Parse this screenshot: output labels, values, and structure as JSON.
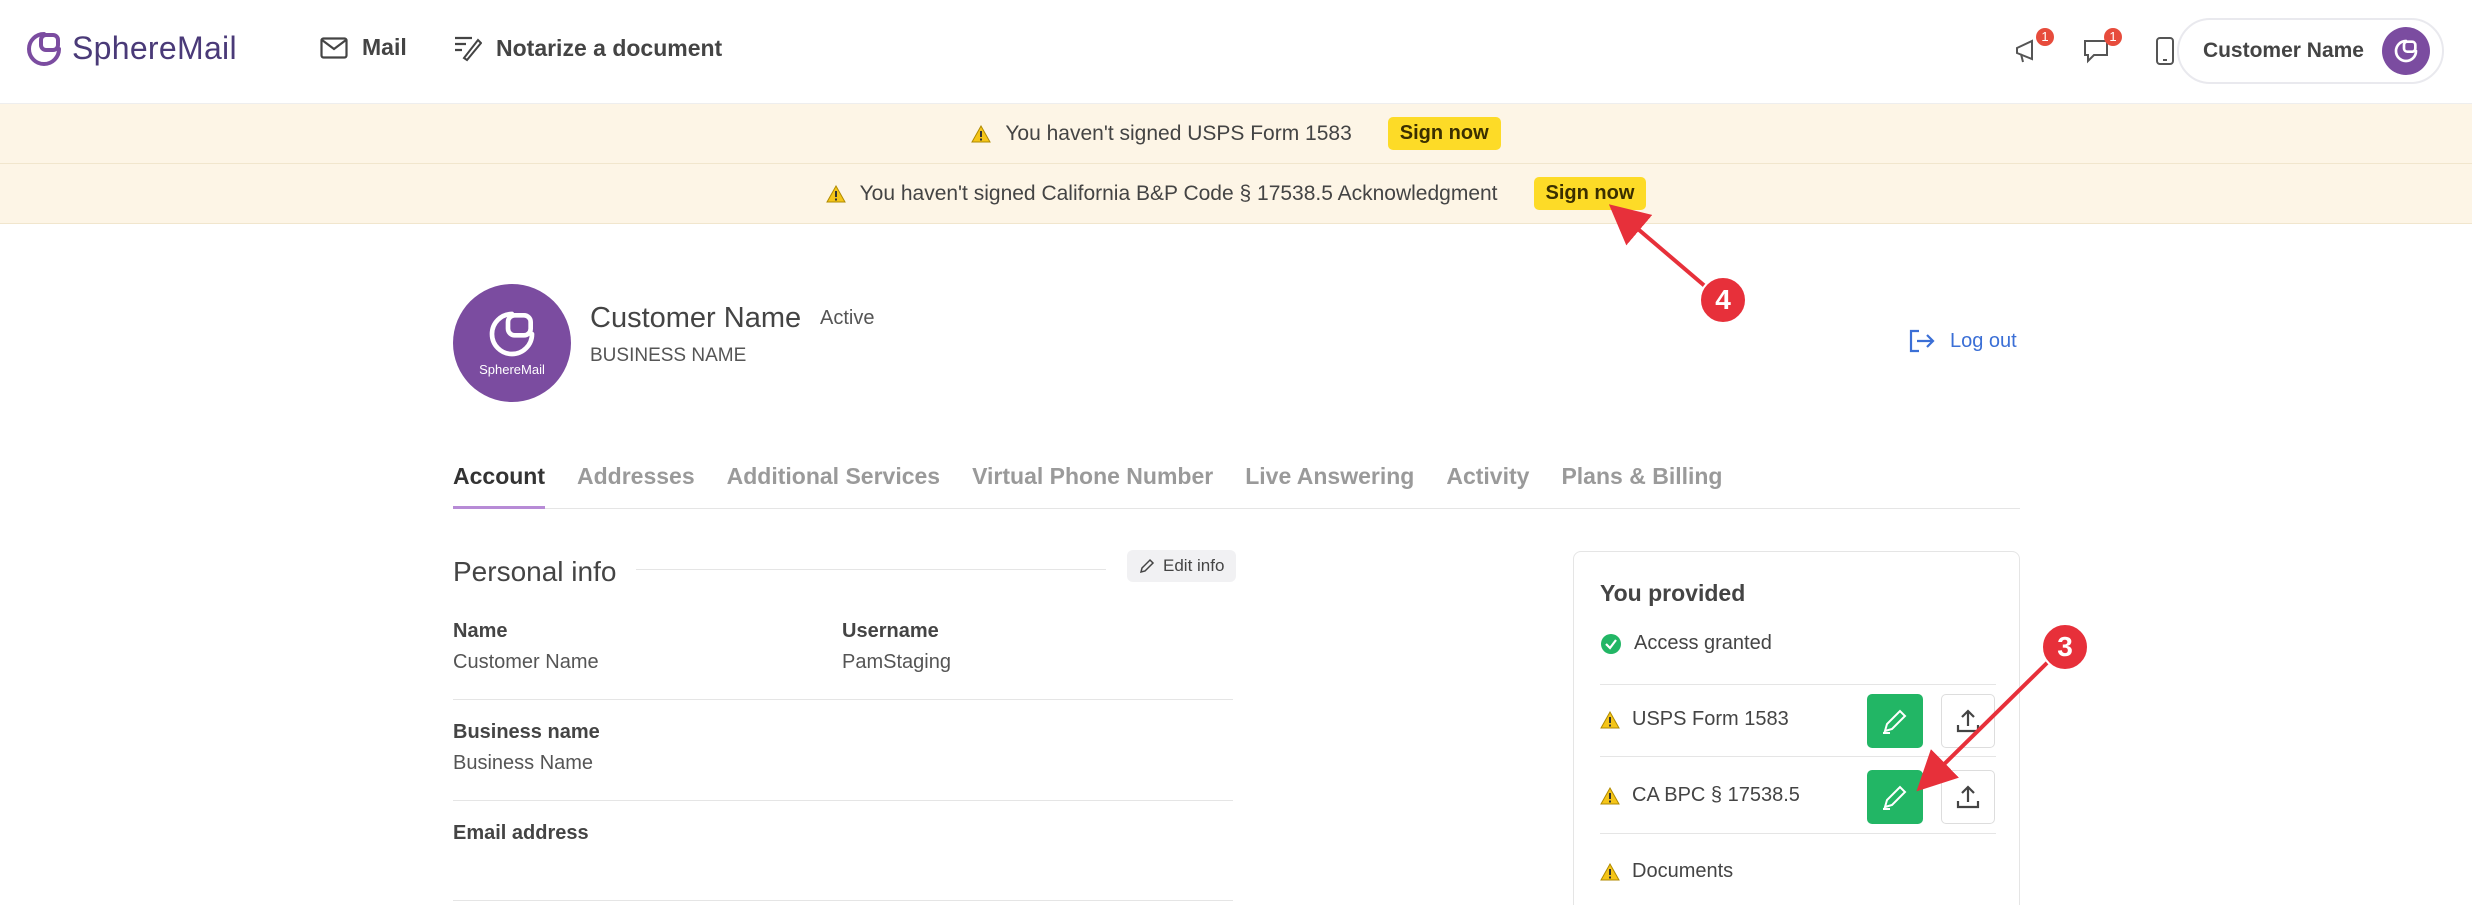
{
  "brand": {
    "name": "SphereMail",
    "accent": "#7b4ca0",
    "logo_caption": "SphereMail"
  },
  "nav": {
    "mail": "Mail",
    "notarize": "Notarize a document"
  },
  "header": {
    "announce_count": "1",
    "messages_count": "1",
    "user_name": "Customer Name"
  },
  "banners": [
    {
      "text": "You haven't signed USPS Form 1583",
      "button": "Sign now"
    },
    {
      "text": "You haven't signed California B&P Code § 17538.5 Acknowledgment",
      "button": "Sign now"
    }
  ],
  "profile": {
    "name": "Customer Name",
    "status": "Active",
    "business": "BUSINESS NAME",
    "logout": "Log out"
  },
  "tabs": [
    "Account",
    "Addresses",
    "Additional Services",
    "Virtual Phone Number",
    "Live Answering",
    "Activity",
    "Plans & Billing"
  ],
  "personal_info": {
    "title": "Personal info",
    "edit": "Edit info",
    "name_label": "Name",
    "name_value": "Customer Name",
    "username_label": "Username",
    "username_value": "PamStaging",
    "business_label": "Business name",
    "business_value": "Business Name",
    "email_label": "Email address"
  },
  "provided": {
    "title": "You provided",
    "access": "Access granted",
    "usps": "USPS Form 1583",
    "ca": "CA BPC § 17538.5",
    "documents": "Documents"
  },
  "annotations": {
    "a3": "3",
    "a4": "4"
  },
  "colors": {
    "banner_bg": "#fdf5e6",
    "sign_yellow": "#fddb27",
    "green": "#22b665",
    "annotation_red": "#e7303a"
  }
}
